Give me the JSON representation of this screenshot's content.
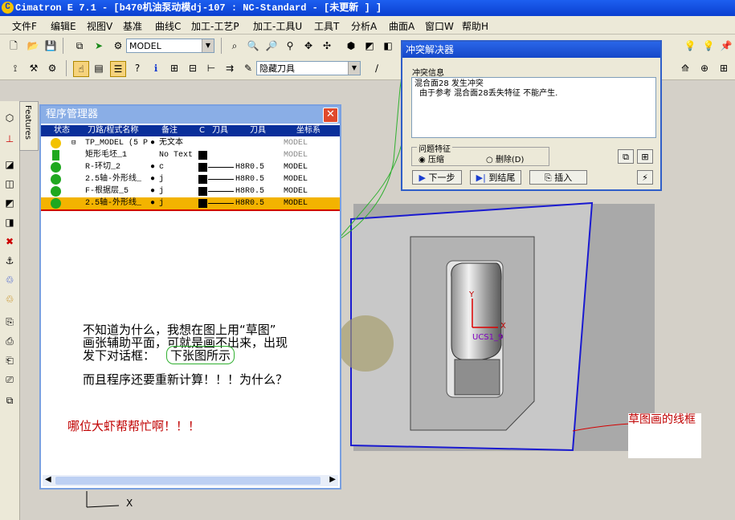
{
  "window": {
    "title": "Cimatron E 7.1 - [b470机油泵动模dj-107 : NC-Standard - [未更新 ] ]"
  },
  "menu": [
    "文件F",
    "编辑E",
    "视图V",
    "基准",
    "曲线C",
    "加工-工艺P",
    "加工-工具U",
    "工具T",
    "分析A",
    "曲面A",
    "窗口W",
    "帮助H"
  ],
  "toolbar1": {
    "model_combo": "MODEL"
  },
  "toolbar2": {
    "hide_tool_combo": "隐藏刀具"
  },
  "side_tab": "Features",
  "program_manager": {
    "title": "程序管理器",
    "columns": [
      "状态",
      "刀路/程式名称",
      "备注",
      "C",
      "刀具",
      "刀具",
      "坐标系"
    ],
    "rows": [
      {
        "status": "yellow",
        "name": "TP_MODEL (5 P",
        "note": "无文本",
        "c": "",
        "tool1": "",
        "tool2": "",
        "cs": "MODEL"
      },
      {
        "status": "none",
        "name": "矩形毛坯_1",
        "note": "No Text",
        "c": "blk",
        "tool1": "",
        "tool2": "",
        "cs": "MODEL"
      },
      {
        "status": "green",
        "name": "R-环切_2",
        "note": "c",
        "c": "blk",
        "tool1": "",
        "tool2": "H8R0.5",
        "cs": "MODEL"
      },
      {
        "status": "green",
        "name": "2.5轴-外形线_",
        "note": "j",
        "c": "blk",
        "tool1": "",
        "tool2": "H8R0.5",
        "cs": "MODEL"
      },
      {
        "status": "green",
        "name": "F-根据层_5",
        "note": "j",
        "c": "blk",
        "tool1": "",
        "tool2": "H8R0.5",
        "cs": "MODEL"
      },
      {
        "status": "green",
        "name": "2.5轴-外形线_",
        "note": "j",
        "c": "blk",
        "tool1": "",
        "tool2": "H8R0.5",
        "cs": "MODEL",
        "selected": true
      }
    ]
  },
  "annotation": {
    "line1": "不知道为什么，我想在图上用“草图”",
    "line2": "画张辅助平面，可就是画不出来，出现",
    "line3_a": "发下对话框：",
    "line3_b": "下张图所示",
    "line4": "而且程序还要重新计算！！！为什么？",
    "line5": "哪位大虾帮帮忙啊！！！",
    "sketch_label": "草图画的线框",
    "color_red": "#c00000",
    "color_green": "#00a000"
  },
  "conflict_dialog": {
    "title": "冲突解决器",
    "info_label": "冲突信息",
    "info_line1": "混合面28 发生冲突",
    "info_line2": "由于参考 混合面28丢失特征  不能产生.",
    "group_label": "问题特征",
    "radio_compress": "压缩",
    "radio_delete": "删除(D)",
    "btn_next": "下一步",
    "btn_jump": "到结尾",
    "btn_insert": "插入"
  },
  "viewport": {
    "axis_y": "Y",
    "axis_x": "X",
    "ucs_label": "UCS1_9",
    "corner_axis_x": "X"
  }
}
